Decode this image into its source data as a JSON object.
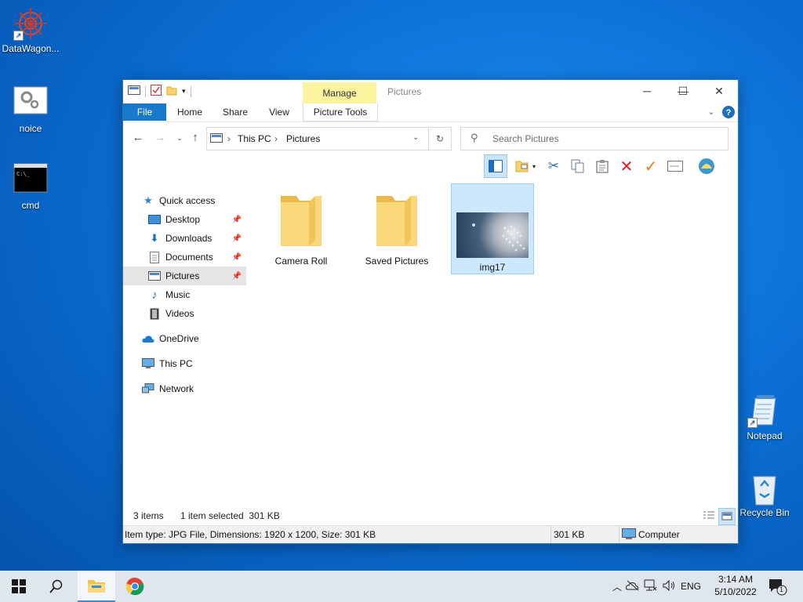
{
  "desktop": {
    "icons": [
      {
        "label": "DataWagon..."
      },
      {
        "label": "noice"
      },
      {
        "label": "cmd"
      },
      {
        "label": "Notepad"
      },
      {
        "label": "Recycle Bin"
      }
    ]
  },
  "window": {
    "title": "Pictures",
    "manage_tab": "Manage",
    "ribbon_tabs": [
      "File",
      "Home",
      "Share",
      "View",
      "Picture Tools"
    ],
    "address": {
      "crumbs": [
        "This PC",
        "Pictures"
      ]
    },
    "search_placeholder": "Search Pictures",
    "nav": {
      "quick_access": "Quick access",
      "items": [
        "Desktop",
        "Downloads",
        "Documents",
        "Pictures",
        "Music",
        "Videos"
      ],
      "onedrive": "OneDrive",
      "this_pc": "This PC",
      "network": "Network"
    },
    "files": [
      {
        "name": "Camera Roll",
        "type": "folder"
      },
      {
        "name": "Saved Pictures",
        "type": "folder"
      },
      {
        "name": "img17",
        "type": "image",
        "selected": true
      }
    ],
    "status": {
      "count": "3 items",
      "selection": "1 item selected  301 KB"
    },
    "details": {
      "info": "Item type: JPG File, Dimensions: 1920 x 1200, Size: 301 KB",
      "size": "301 KB",
      "location": "Computer"
    }
  },
  "taskbar": {
    "lang": "ENG",
    "time": "3:14 AM",
    "date": "5/10/2022",
    "notification_count": "1"
  },
  "colors": {
    "accent": "#1979ca",
    "manage_tab": "#fbf39e",
    "selection": "#cce8ff"
  }
}
